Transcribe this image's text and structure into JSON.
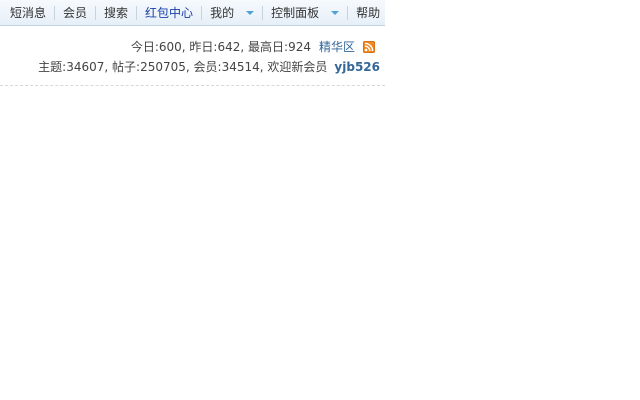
{
  "nav": {
    "items": [
      {
        "label": "短消息"
      },
      {
        "label": "会员"
      },
      {
        "label": "搜索"
      },
      {
        "label": "红包中心"
      },
      {
        "label": "我的"
      },
      {
        "label": "控制面板"
      },
      {
        "label": "帮助"
      }
    ]
  },
  "stats": {
    "today_label": "今日: ",
    "today_value": "600",
    "yesterday_label": ", 昨日: ",
    "yesterday_value": "642",
    "highest_label": ", 最高日: ",
    "highest_value": "924",
    "digest_link": "精华区",
    "topics_label": "主题: ",
    "topics_value": "34607",
    "posts_label": ", 帖子: ",
    "posts_value": "250705",
    "members_label": ", 会员: ",
    "members_value": "34514",
    "welcome_label": ", 欢迎新会员",
    "newest_member": "yjb526"
  },
  "colors": {
    "link": "#336699",
    "highlight_nav": "#1a3fa8",
    "rss": "#f08a24"
  }
}
